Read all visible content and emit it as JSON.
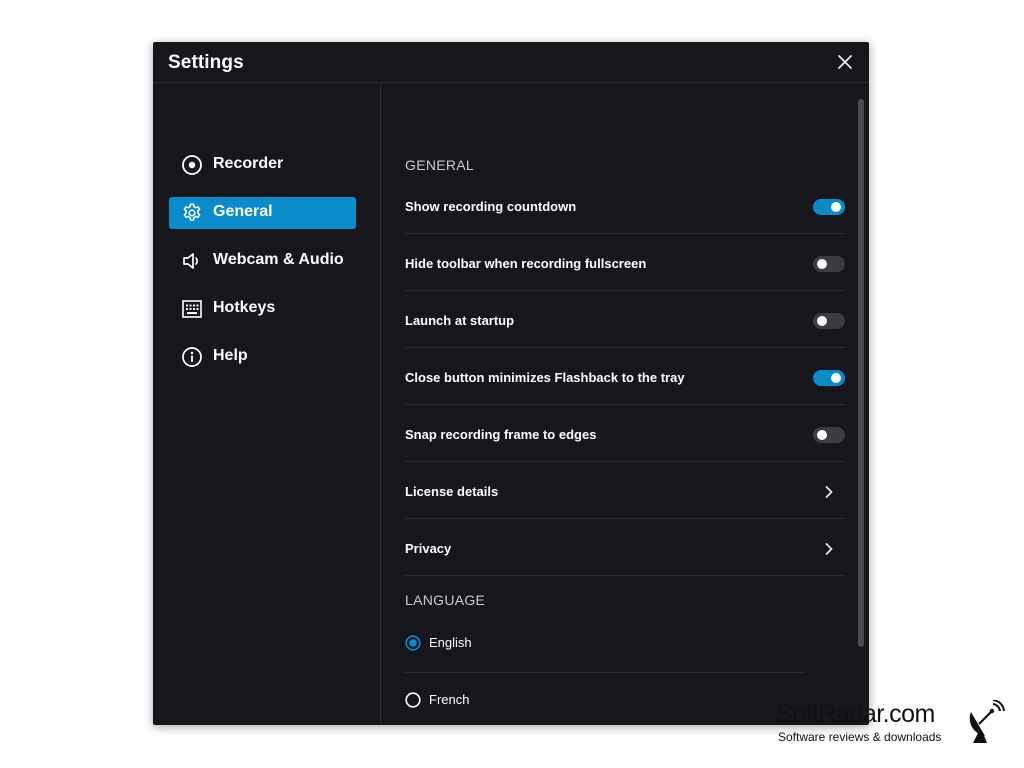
{
  "window": {
    "title": "Settings",
    "close_icon": "close-icon"
  },
  "sidebar": {
    "items": [
      {
        "label": "Recorder",
        "icon": "record-icon",
        "active": false
      },
      {
        "label": "General",
        "icon": "gear-icon",
        "active": true
      },
      {
        "label": "Webcam & Audio",
        "icon": "speaker-icon",
        "active": false
      },
      {
        "label": "Hotkeys",
        "icon": "keyboard-icon",
        "active": false
      },
      {
        "label": "Help",
        "icon": "info-icon",
        "active": false
      }
    ]
  },
  "general": {
    "header": "GENERAL",
    "settings": [
      {
        "label": "Show recording countdown",
        "type": "toggle",
        "enabled": true
      },
      {
        "label": "Hide toolbar when recording fullscreen",
        "type": "toggle",
        "enabled": false
      },
      {
        "label": "Launch at startup",
        "type": "toggle",
        "enabled": false
      },
      {
        "label": "Close button minimizes Flashback to the tray",
        "type": "toggle",
        "enabled": true
      },
      {
        "label": "Snap recording frame to edges",
        "type": "toggle",
        "enabled": false
      },
      {
        "label": "License details",
        "type": "link"
      },
      {
        "label": "Privacy",
        "type": "link"
      }
    ]
  },
  "language": {
    "header": "LANGUAGE",
    "options": [
      {
        "label": "English",
        "selected": true
      },
      {
        "label": "French",
        "selected": false
      }
    ]
  },
  "watermark": {
    "title": "SoftRadar.com",
    "subtitle": "Software reviews & downloads",
    "icon": "satellite-dish-icon"
  },
  "colors": {
    "accent": "#0a8ccb",
    "background": "#16171c",
    "divider": "#2a2b31",
    "toggle_off": "#3b3c43"
  }
}
